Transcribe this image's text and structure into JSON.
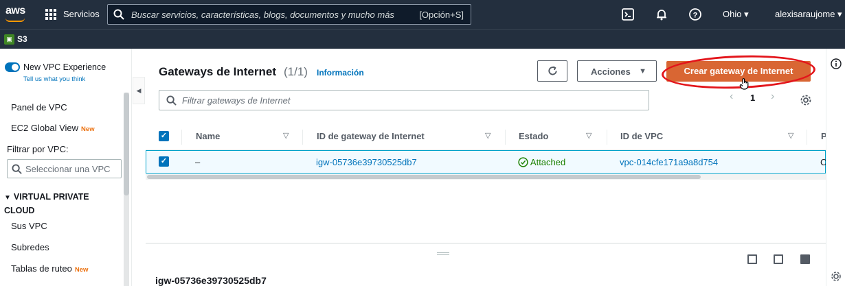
{
  "topbar": {
    "logo": "aws",
    "services_label": "Servicios",
    "search_placeholder": "Buscar servicios, características, blogs, documentos y mucho más",
    "search_shortcut": "[Opción+S]",
    "region": "Ohio ▾",
    "user": "alexisaraujome ▾",
    "icons": [
      "cloudshell-icon",
      "bell-icon",
      "help-icon"
    ]
  },
  "favorites": {
    "s3_label": "S3"
  },
  "sidebar": {
    "new_vpc_label": "New VPC Experience",
    "tell_us": "Tell us what you think",
    "panel_vpc": "Panel de VPC",
    "ec2_global": "EC2 Global View",
    "new_badge": "New",
    "filter_label": "Filtrar por VPC:",
    "select_placeholder": "Seleccionar una VPC",
    "section": "VIRTUAL PRIVATE CLOUD",
    "items": [
      "Sus VPC",
      "Subredes",
      "Tablas de ruteo"
    ]
  },
  "main": {
    "title": "Gateways de Internet",
    "count": "(1/1)",
    "info": "Información",
    "actions_label": "Acciones",
    "create_label": "Crear gateway de Internet",
    "filter_placeholder": "Filtrar gateways de Internet",
    "page": "1",
    "columns": [
      "Name",
      "ID de gateway de Internet",
      "Estado",
      "ID de VPC",
      "P"
    ],
    "row": {
      "name": "–",
      "gateway_id": "igw-05736e39730525db7",
      "state": "Attached",
      "vpc_id": "vpc-014cfe171a9a8d754",
      "extra": "C"
    },
    "detail_title": "igw-05736e39730525db7"
  },
  "colors": {
    "topbar": "#232f3e",
    "primary": "#d96633",
    "link": "#0073bb",
    "success": "#1d8102",
    "annotation": "#e3151b"
  }
}
